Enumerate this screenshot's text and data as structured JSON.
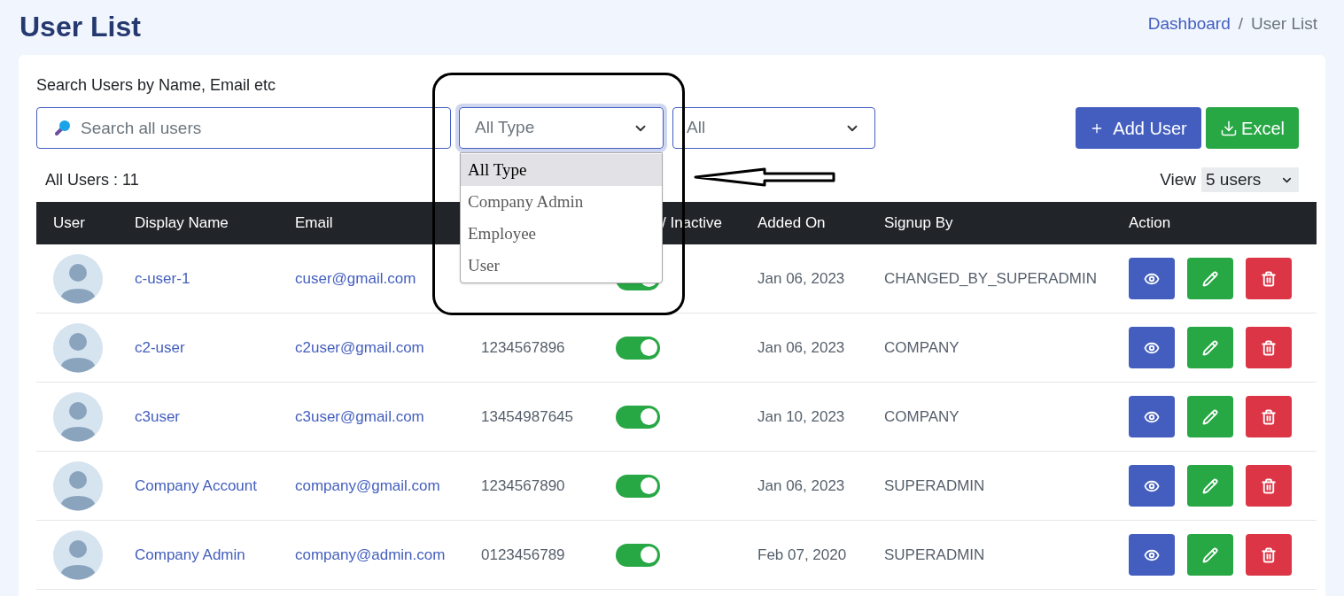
{
  "page_title": "User List",
  "breadcrumb": {
    "link": "Dashboard",
    "separator": "/",
    "current": "User List"
  },
  "search": {
    "label": "Search Users by Name, Email etc",
    "placeholder": "Search all users"
  },
  "type_filter": {
    "value": "All Type",
    "expanded": true,
    "options": [
      {
        "label": "All Type",
        "selected": true
      },
      {
        "label": "Company Admin",
        "selected": false
      },
      {
        "label": "Employee",
        "selected": false
      },
      {
        "label": "User",
        "selected": false
      }
    ]
  },
  "status_filter": {
    "value": "All"
  },
  "add_button": "Add User",
  "excel_button": "Excel",
  "total": "All Users : 11",
  "view": {
    "label": "View",
    "value": "5 users"
  },
  "table": {
    "columns": [
      "User",
      "Display Name",
      "Email",
      "/ Inactive",
      "Added On",
      "Signup By",
      "Action"
    ],
    "rows": [
      {
        "display_name": "c-user-1",
        "email": "cuser@gmail.com",
        "active": true,
        "added_on": "Jan 06, 2023",
        "signup_by": "CHANGED_BY_SUPERADMIN"
      },
      {
        "display_name": "c2-user",
        "email": "c2user@gmail.com",
        "phone": "1234567896",
        "active": true,
        "added_on": "Jan 06, 2023",
        "signup_by": "COMPANY"
      },
      {
        "display_name": "c3user",
        "email": "c3user@gmail.com",
        "phone": "13454987645",
        "active": true,
        "added_on": "Jan 10, 2023",
        "signup_by": "COMPANY"
      },
      {
        "display_name": "Company Account",
        "email": "company@gmail.com",
        "phone": "1234567890",
        "active": true,
        "added_on": "Jan 06, 2023",
        "signup_by": "SUPERADMIN"
      },
      {
        "display_name": "Company Admin",
        "email": "company@admin.com",
        "phone": "0123456789",
        "active": true,
        "added_on": "Feb 07, 2020",
        "signup_by": "SUPERADMIN"
      }
    ]
  }
}
